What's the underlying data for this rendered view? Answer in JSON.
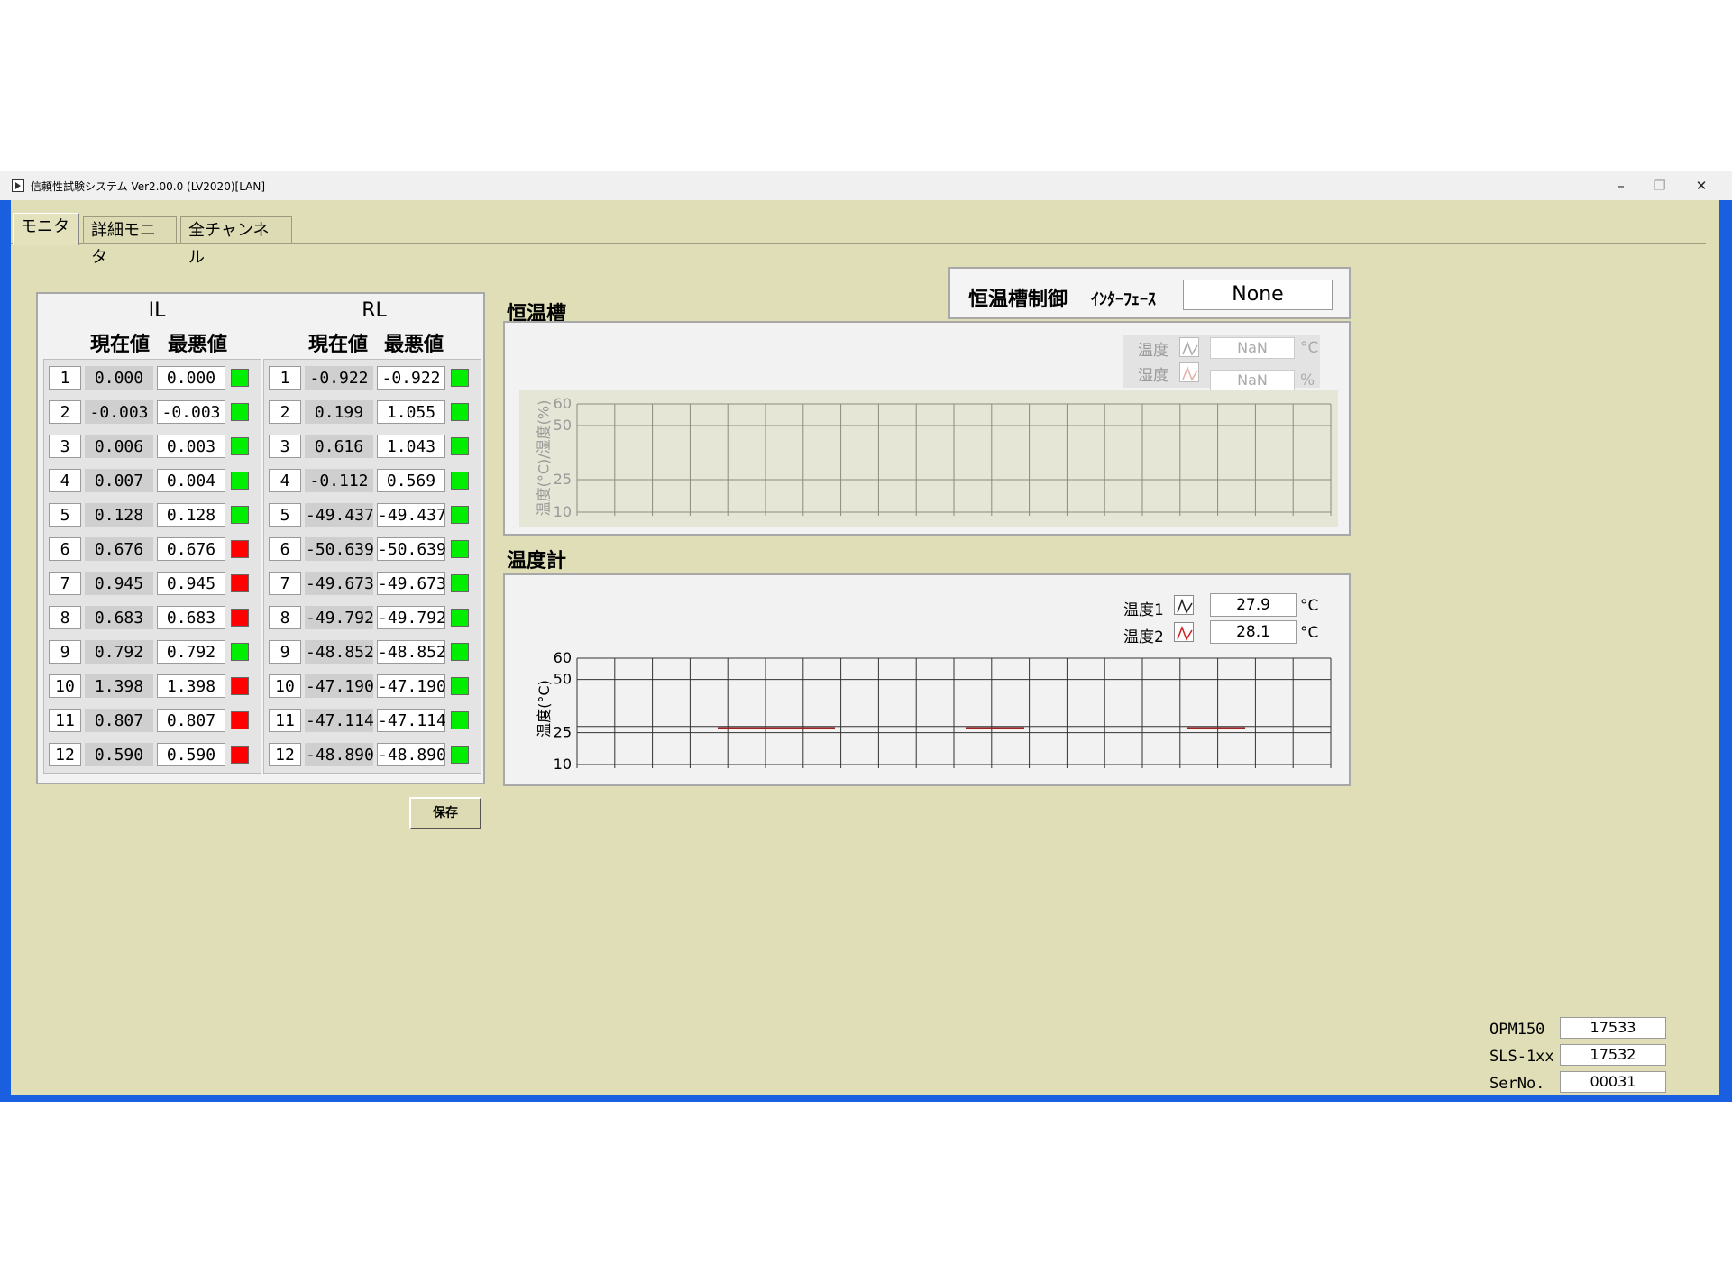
{
  "window": {
    "title": "信頼性試験システム Ver2.00.0  (LV2020)[LAN]",
    "minimize": "–",
    "maximize": "❐",
    "close": "✕"
  },
  "tabs": [
    {
      "label": "モニタ"
    },
    {
      "label": "詳細モニタ"
    },
    {
      "label": "全チャンネル"
    }
  ],
  "il": {
    "title": "IL",
    "col_current": "現在値",
    "col_worst": "最悪値",
    "rows": [
      {
        "ch": "1",
        "current": "0.000",
        "worst": "0.000",
        "status": "green"
      },
      {
        "ch": "2",
        "current": "-0.003",
        "worst": "-0.003",
        "status": "green"
      },
      {
        "ch": "3",
        "current": "0.006",
        "worst": "0.003",
        "status": "green"
      },
      {
        "ch": "4",
        "current": "0.007",
        "worst": "0.004",
        "status": "green"
      },
      {
        "ch": "5",
        "current": "0.128",
        "worst": "0.128",
        "status": "green"
      },
      {
        "ch": "6",
        "current": "0.676",
        "worst": "0.676",
        "status": "red"
      },
      {
        "ch": "7",
        "current": "0.945",
        "worst": "0.945",
        "status": "red"
      },
      {
        "ch": "8",
        "current": "0.683",
        "worst": "0.683",
        "status": "red"
      },
      {
        "ch": "9",
        "current": "0.792",
        "worst": "0.792",
        "status": "green"
      },
      {
        "ch": "10",
        "current": "1.398",
        "worst": "1.398",
        "status": "red"
      },
      {
        "ch": "11",
        "current": "0.807",
        "worst": "0.807",
        "status": "red"
      },
      {
        "ch": "12",
        "current": "0.590",
        "worst": "0.590",
        "status": "red"
      }
    ]
  },
  "rl": {
    "title": "RL",
    "col_current": "現在値",
    "col_worst": "最悪値",
    "rows": [
      {
        "ch": "1",
        "current": "-0.922",
        "worst": "-0.922",
        "status": "green"
      },
      {
        "ch": "2",
        "current": "0.199",
        "worst": "1.055",
        "status": "green"
      },
      {
        "ch": "3",
        "current": "0.616",
        "worst": "1.043",
        "status": "green"
      },
      {
        "ch": "4",
        "current": "-0.112",
        "worst": "0.569",
        "status": "green"
      },
      {
        "ch": "5",
        "current": "-49.437",
        "worst": "-49.437",
        "status": "green"
      },
      {
        "ch": "6",
        "current": "-50.639",
        "worst": "-50.639",
        "status": "green"
      },
      {
        "ch": "7",
        "current": "-49.673",
        "worst": "-49.673",
        "status": "green"
      },
      {
        "ch": "8",
        "current": "-49.792",
        "worst": "-49.792",
        "status": "green"
      },
      {
        "ch": "9",
        "current": "-48.852",
        "worst": "-48.852",
        "status": "green"
      },
      {
        "ch": "10",
        "current": "-47.190",
        "worst": "-47.190",
        "status": "green"
      },
      {
        "ch": "11",
        "current": "-47.114",
        "worst": "-47.114",
        "status": "green"
      },
      {
        "ch": "12",
        "current": "-48.890",
        "worst": "-48.890",
        "status": "green"
      }
    ]
  },
  "colors": {
    "green": "#00ee00",
    "red": "#ff0000",
    "panel": "#dfdeb6",
    "window_border": "#1a5fe0"
  },
  "save_label": "保存",
  "chamber": {
    "control_label": "恒温槽制御",
    "interface_label": "ｲﾝﾀｰﾌｪｰｽ",
    "interface_value": "None",
    "section_title": "恒温槽",
    "temp_label": "温度",
    "temp_value": "NaN",
    "temp_unit": "°C",
    "hum_label": "湿度",
    "hum_value": "NaN",
    "hum_unit": "%",
    "yaxis_label": "温度(°C)/湿度(%)",
    "yticks": [
      "60",
      "50",
      "25",
      "10"
    ]
  },
  "thermometer": {
    "section_title": "温度計",
    "t1_label": "温度1",
    "t1_value": "27.9",
    "t1_unit": "°C",
    "t2_label": "温度2",
    "t2_value": "28.1",
    "t2_unit": "°C",
    "yaxis_label": "温度(°C)",
    "yticks": [
      "60",
      "50",
      "25",
      "10"
    ]
  },
  "serials": [
    {
      "label": "OPM150",
      "value": "17533"
    },
    {
      "label": "SLS-1xx",
      "value": "17532"
    },
    {
      "label": "SerNo.",
      "value": "00031"
    }
  ]
}
